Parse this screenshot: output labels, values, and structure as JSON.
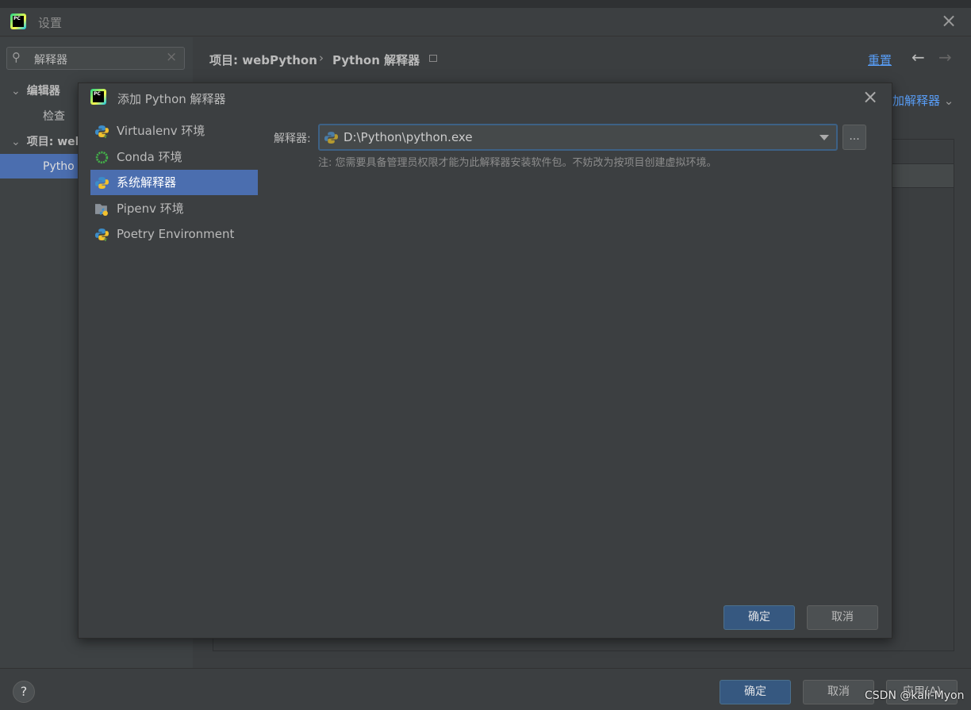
{
  "window": {
    "title": "设置",
    "close": "×"
  },
  "search": {
    "value": "解释器"
  },
  "tree": [
    {
      "label": "编辑器"
    },
    {
      "label": "检查"
    },
    {
      "label": "项目: wel"
    },
    {
      "label": "Pytho"
    }
  ],
  "header": {
    "breadcrumb_project": "项目: webPython",
    "breadcrumb_sep": "›",
    "breadcrumb_page": "Python 解释器",
    "reset": "重置",
    "back": "←",
    "forward": "→",
    "add_interpreter": "加解释器"
  },
  "footer": {
    "help": "?",
    "ok": "确定",
    "cancel": "取消",
    "apply": "应用(A)"
  },
  "watermark": "CSDN @kali-Myon",
  "dialog": {
    "title": "添加 Python 解释器",
    "close": "×",
    "items": [
      {
        "label": "Virtualenv 环境",
        "icon": "python-virtualenv-icon"
      },
      {
        "label": "Conda 环境",
        "icon": "conda-icon"
      },
      {
        "label": "系统解释器",
        "icon": "python-icon"
      },
      {
        "label": "Pipenv 环境",
        "icon": "pipenv-icon"
      },
      {
        "label": "Poetry Environment",
        "icon": "python-poetry-icon"
      }
    ],
    "selected_index": 2,
    "interpreter_label": "解释器:",
    "interpreter_value": "D:\\Python\\python.exe",
    "browse": "...",
    "note": "注: 您需要具备管理员权限才能为此解释器安装软件包。不妨改为按项目创建虚拟环境。",
    "ok": "确定",
    "cancel": "取消"
  },
  "colors": {
    "accent": "#4b6eaf",
    "link": "#589df6",
    "primary_button": "#365880"
  }
}
